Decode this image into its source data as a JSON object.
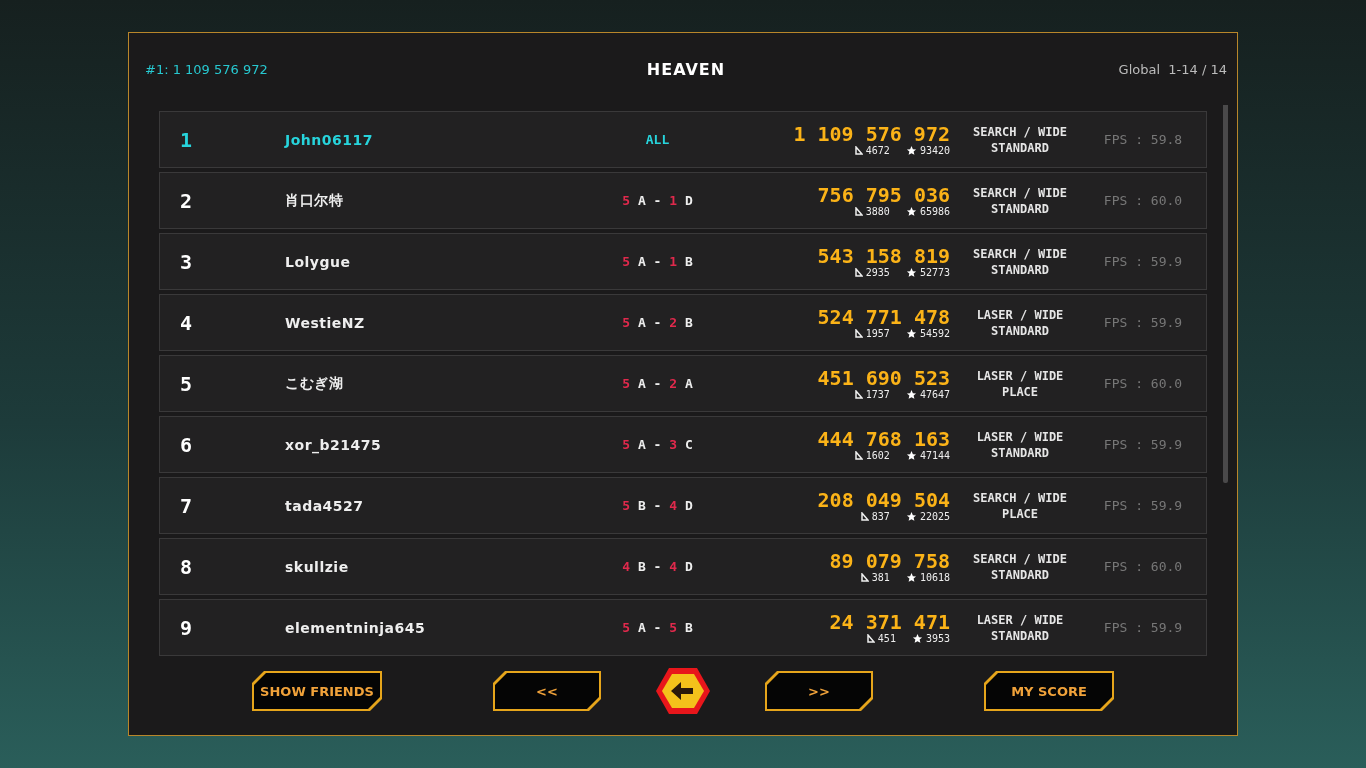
{
  "header": {
    "top_score": "#1: 1 109 576 972",
    "title": "HEAVEN",
    "range": "Global  1-14 / 14"
  },
  "rows": [
    {
      "rank": "1",
      "name": "John06117",
      "selected": true,
      "stage": {
        "kind": "all",
        "text": "ALL"
      },
      "score": "1 109 576 972",
      "triangles": "4672",
      "stars": "93420",
      "mode": "SEARCH / WIDE",
      "style": "STANDARD",
      "fps": "FPS : 59.8"
    },
    {
      "rank": "2",
      "name": "肖口尔特",
      "selected": false,
      "stage": {
        "kind": "split",
        "parts": [
          {
            "kind": "number",
            "text": "5"
          },
          {
            "kind": "letter",
            "text": "A"
          },
          {
            "kind": "letter",
            "text": "-"
          },
          {
            "kind": "number",
            "text": "1"
          },
          {
            "kind": "letter",
            "text": "D"
          }
        ]
      },
      "score": "756 795 036",
      "triangles": "3880",
      "stars": "65986",
      "mode": "SEARCH / WIDE",
      "style": "STANDARD",
      "fps": "FPS : 60.0"
    },
    {
      "rank": "3",
      "name": "Lolygue",
      "selected": false,
      "stage": {
        "kind": "split",
        "parts": [
          {
            "kind": "number",
            "text": "5"
          },
          {
            "kind": "letter",
            "text": "A"
          },
          {
            "kind": "letter",
            "text": "-"
          },
          {
            "kind": "number",
            "text": "1"
          },
          {
            "kind": "letter",
            "text": "B"
          }
        ]
      },
      "score": "543 158 819",
      "triangles": "2935",
      "stars": "52773",
      "mode": "SEARCH / WIDE",
      "style": "STANDARD",
      "fps": "FPS : 59.9"
    },
    {
      "rank": "4",
      "name": "WestieNZ",
      "selected": false,
      "stage": {
        "kind": "split",
        "parts": [
          {
            "kind": "number",
            "text": "5"
          },
          {
            "kind": "letter",
            "text": "A"
          },
          {
            "kind": "letter",
            "text": "-"
          },
          {
            "kind": "number",
            "text": "2"
          },
          {
            "kind": "letter",
            "text": "B"
          }
        ]
      },
      "score": "524 771 478",
      "triangles": "1957",
      "stars": "54592",
      "mode": "LASER / WIDE",
      "style": "STANDARD",
      "fps": "FPS : 59.9"
    },
    {
      "rank": "5",
      "name": "こむぎ湖",
      "selected": false,
      "stage": {
        "kind": "split",
        "parts": [
          {
            "kind": "number",
            "text": "5"
          },
          {
            "kind": "letter",
            "text": "A"
          },
          {
            "kind": "letter",
            "text": "-"
          },
          {
            "kind": "number",
            "text": "2"
          },
          {
            "kind": "letter",
            "text": "A"
          }
        ]
      },
      "score": "451 690 523",
      "triangles": "1737",
      "stars": "47647",
      "mode": "LASER / WIDE",
      "style": "PLACE",
      "fps": "FPS : 60.0"
    },
    {
      "rank": "6",
      "name": "xor_b21475",
      "selected": false,
      "stage": {
        "kind": "split",
        "parts": [
          {
            "kind": "number",
            "text": "5"
          },
          {
            "kind": "letter",
            "text": "A"
          },
          {
            "kind": "letter",
            "text": "-"
          },
          {
            "kind": "number",
            "text": "3"
          },
          {
            "kind": "letter",
            "text": "C"
          }
        ]
      },
      "score": "444 768 163",
      "triangles": "1602",
      "stars": "47144",
      "mode": "LASER / WIDE",
      "style": "STANDARD",
      "fps": "FPS : 59.9"
    },
    {
      "rank": "7",
      "name": "tada4527",
      "selected": false,
      "stage": {
        "kind": "split",
        "parts": [
          {
            "kind": "number",
            "text": "5"
          },
          {
            "kind": "letter",
            "text": "B"
          },
          {
            "kind": "letter",
            "text": "-"
          },
          {
            "kind": "number",
            "text": "4"
          },
          {
            "kind": "letter",
            "text": "D"
          }
        ]
      },
      "score": "208 049 504",
      "triangles": "837",
      "stars": "22025",
      "mode": "SEARCH / WIDE",
      "style": "PLACE",
      "fps": "FPS : 59.9"
    },
    {
      "rank": "8",
      "name": "skullzie",
      "selected": false,
      "stage": {
        "kind": "split",
        "parts": [
          {
            "kind": "number",
            "text": "4"
          },
          {
            "kind": "letter",
            "text": "B"
          },
          {
            "kind": "letter",
            "text": "-"
          },
          {
            "kind": "number",
            "text": "4"
          },
          {
            "kind": "letter",
            "text": "D"
          }
        ]
      },
      "score": "89 079 758",
      "triangles": "381",
      "stars": "10618",
      "mode": "SEARCH / WIDE",
      "style": "STANDARD",
      "fps": "FPS : 60.0"
    },
    {
      "rank": "9",
      "name": "elementninja645",
      "selected": false,
      "stage": {
        "kind": "split",
        "parts": [
          {
            "kind": "number",
            "text": "5"
          },
          {
            "kind": "letter",
            "text": "A"
          },
          {
            "kind": "letter",
            "text": "-"
          },
          {
            "kind": "number",
            "text": "5"
          },
          {
            "kind": "letter",
            "text": "B"
          }
        ]
      },
      "score": "24 371 471",
      "triangles": "451",
      "stars": "3953",
      "mode": "LASER / WIDE",
      "style": "STANDARD",
      "fps": "FPS : 59.9"
    }
  ],
  "buttons": {
    "friends": "SHOW FRIENDS",
    "prev": "<<",
    "next": ">>",
    "my_score": "MY SCORE"
  }
}
